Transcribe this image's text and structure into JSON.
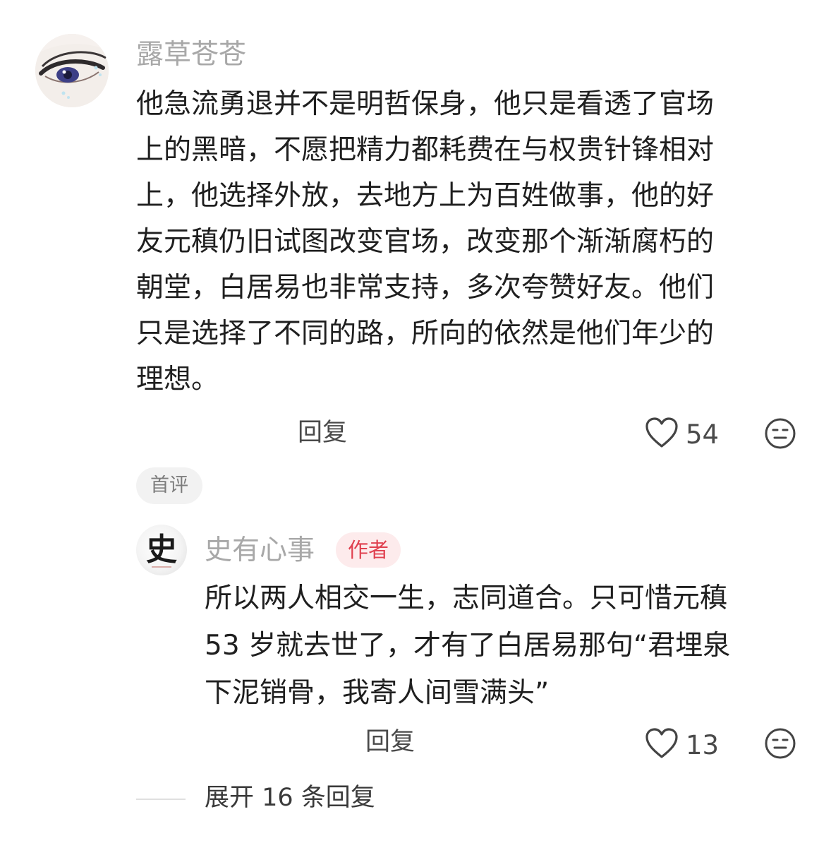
{
  "comment": {
    "username": "露草苍苍",
    "text_lines": [
      "他急流勇退并不是明哲保身，他只是看透了官场",
      "上的黑暗，不愿把精力都耗费在与权贵针锋相对",
      "上，他选择外放，去地方上为百姓做事，他的好",
      "友元稹仍旧试图改变官场，改变那个渐渐腐朽的",
      "朝堂，白居易也非常支持，多次夸赞好友。他们",
      "只是选择了不同的路，所向的依然是他们年少的",
      "理想。"
    ],
    "reply_label": "回复",
    "like_count": "54",
    "tag": "首评"
  },
  "reply": {
    "username": "史有心事",
    "author_badge": "作者",
    "avatar_char": "史",
    "text_lines": [
      "所以两人相交一生，志同道合。只可惜元稹",
      "53 岁就去世了，才有了白居易那句“君埋泉",
      "下泥销骨，我寄人间雪满头”"
    ],
    "reply_label": "回复",
    "like_count": "13"
  },
  "expand": {
    "label": "展开 16 条回复"
  },
  "icons": {
    "like": "heart-outline-icon",
    "dislike": "neutral-face-icon"
  },
  "colors": {
    "author_badge_text": "#e0404f",
    "author_badge_bg": "#fdebec",
    "username": "#a8a8a8"
  }
}
